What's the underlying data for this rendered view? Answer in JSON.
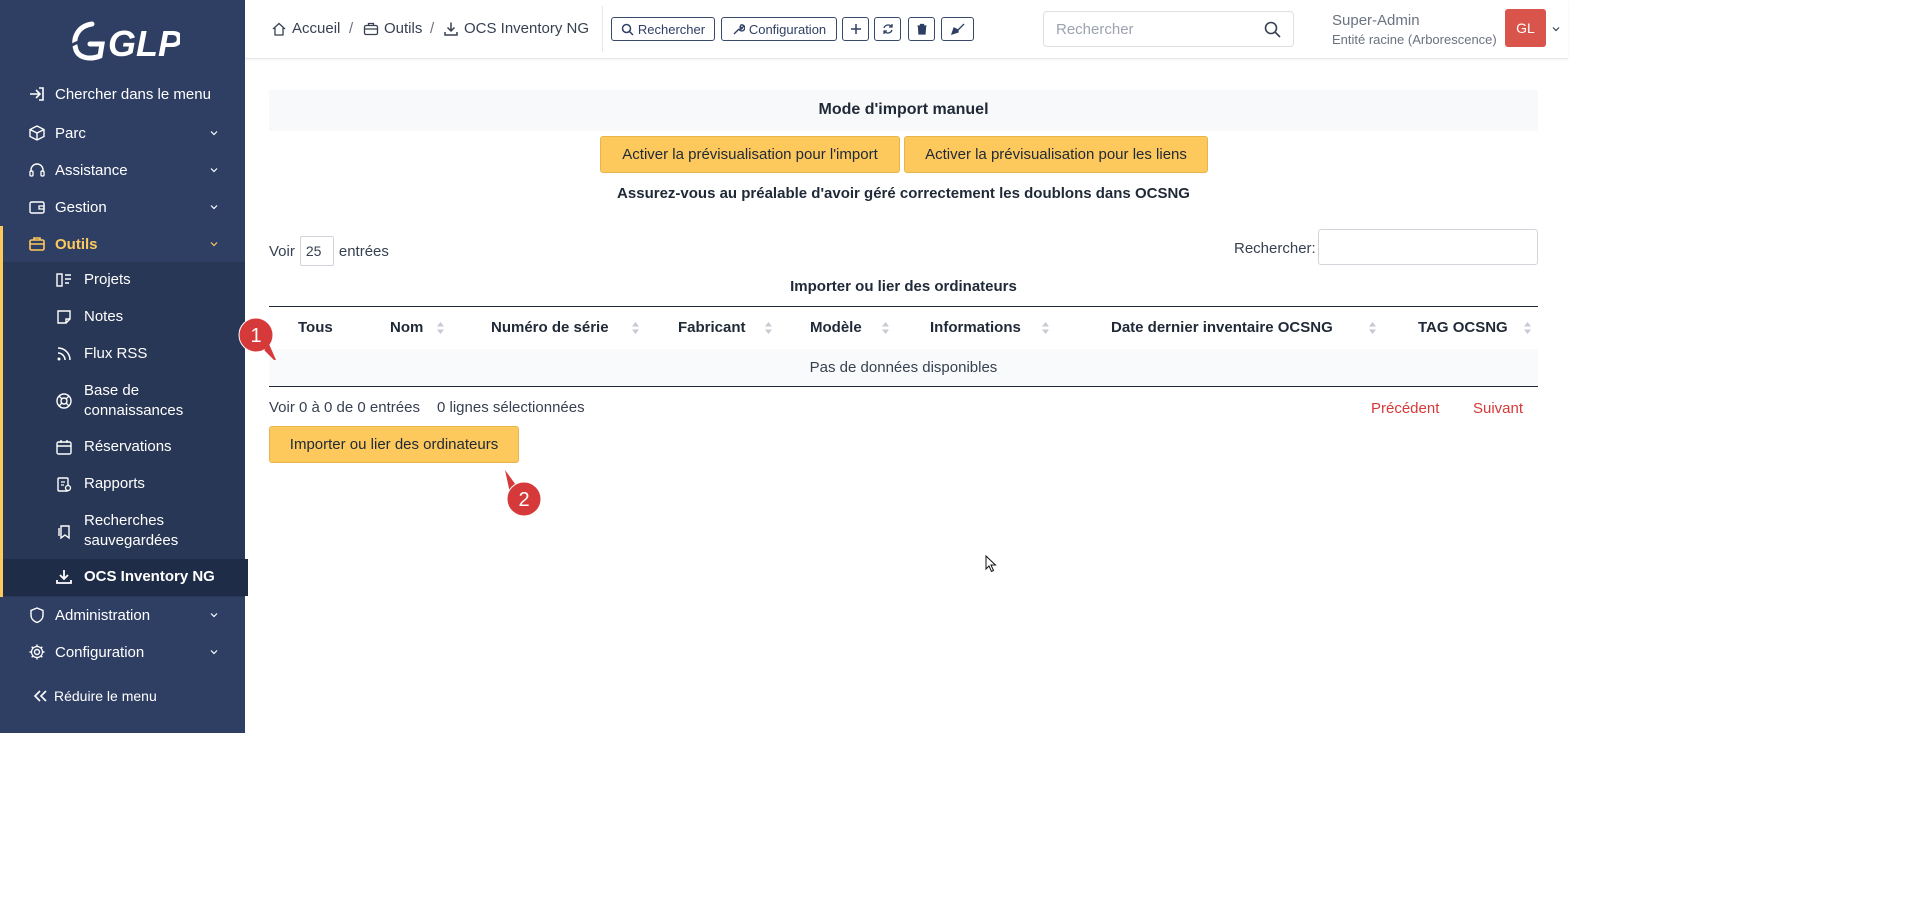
{
  "sidebar": {
    "logo_text": "GLPI",
    "search_menu": "Chercher dans le menu",
    "items": [
      {
        "label": "Parc"
      },
      {
        "label": "Assistance"
      },
      {
        "label": "Gestion"
      },
      {
        "label": "Outils"
      },
      {
        "label": "Administration"
      },
      {
        "label": "Configuration"
      }
    ],
    "subitems": [
      {
        "label": "Projets"
      },
      {
        "label": "Notes"
      },
      {
        "label": "Flux RSS"
      },
      {
        "label_line1": "Base de",
        "label_line2": "connaissances"
      },
      {
        "label": "Réservations"
      },
      {
        "label": "Rapports"
      },
      {
        "label_line1": "Recherches",
        "label_line2": "sauvegardées"
      },
      {
        "label": "OCS Inventory NG"
      }
    ],
    "reduce_label": "Réduire le menu"
  },
  "header": {
    "breadcrumb": [
      "Accueil",
      "Outils",
      "OCS Inventory NG"
    ],
    "separator": "/",
    "buttons": {
      "search": "Rechercher",
      "config": "Configuration"
    },
    "search_placeholder": "Rechercher",
    "user": {
      "name": "Super-Admin",
      "entity": "Entité racine (Arborescence)",
      "initials": "GL"
    }
  },
  "main": {
    "import_title": "Mode d'import manuel",
    "btn_preview_import": "Activer la prévisualisation pour l'import",
    "btn_preview_links": "Activer la prévisualisation pour les liens",
    "warning": "Assurez-vous au préalable d'avoir géré correctement les doublons dans OCSNG",
    "length_prefix": "Voir",
    "length_value": "25",
    "length_suffix": "entrées",
    "search_label": "Rechercher:",
    "table_caption": "Importer ou lier des ordinateurs",
    "columns": [
      "Tous",
      "Nom",
      "Numéro de série",
      "Fabricant",
      "Modèle",
      "Informations",
      "Date dernier inventaire OCSNG",
      "TAG OCSNG"
    ],
    "empty_text": "Pas de données disponibles",
    "info_text": "Voir 0 à 0 de 0 entrées",
    "selected_text": "0 lignes sélectionnées",
    "prev": "Précédent",
    "next": "Suivant",
    "submit_label": "Importer ou lier des ordinateurs"
  },
  "annotations": {
    "marker1": "1",
    "marker2": "2"
  },
  "colors": {
    "sidebar": "#2f3f64",
    "accent": "#fec95c",
    "danger": "#d63939",
    "avatar": "#d9544a"
  }
}
